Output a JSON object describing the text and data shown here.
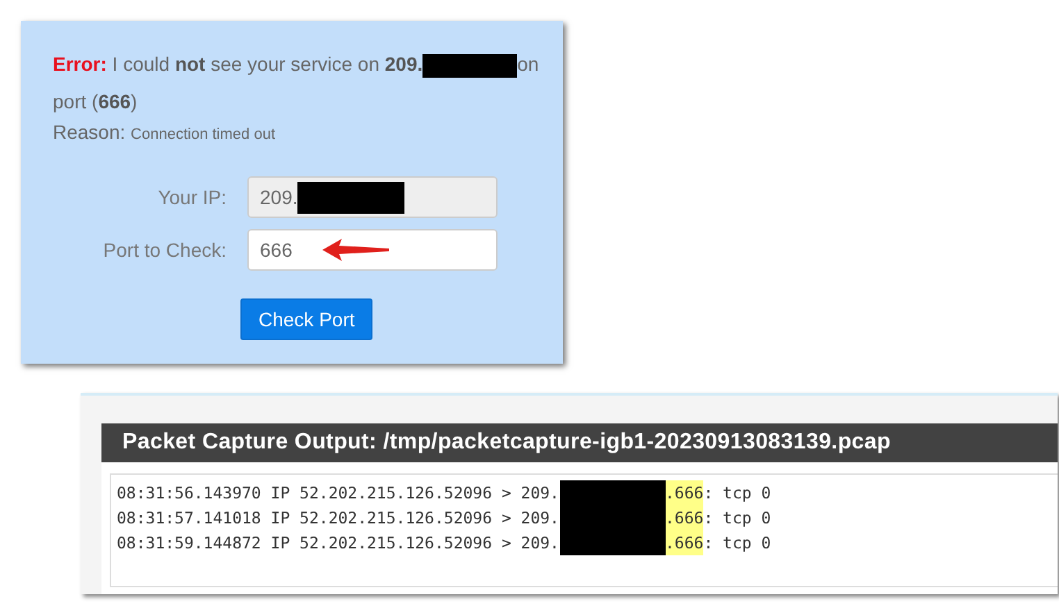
{
  "port_check": {
    "error_label": "Error:",
    "message_before": "I could **not** see your service on **209.**",
    "message_after": "on",
    "message_line2": "port (**666**)",
    "reason_label": "Reason:",
    "reason": "Connection timed out",
    "fields": [
      {
        "label": "Your IP:",
        "value": "209.",
        "disabled": true,
        "redacted": true,
        "arrow": false
      },
      {
        "label": "Port to Check:",
        "value": "666",
        "disabled": false,
        "redacted": false,
        "arrow": true
      }
    ],
    "button": "Check Port"
  },
  "packet_capture": {
    "title": "Packet Capture Output: /tmp/packetcapture-igb1-20230913083139.pcap",
    "lines": [
      {
        "prefix": "08:31:56.143970 IP 52.202.215.126.52096 > 209.",
        "port": ".666",
        "suffix": ": tcp 0"
      },
      {
        "prefix": "08:31:57.141018 IP 52.202.215.126.52096 > 209.",
        "port": ".666",
        "suffix": ": tcp 0"
      },
      {
        "prefix": "08:31:59.144872 IP 52.202.215.126.52096 > 209.",
        "port": ".666",
        "suffix": ": tcp 0"
      }
    ]
  }
}
